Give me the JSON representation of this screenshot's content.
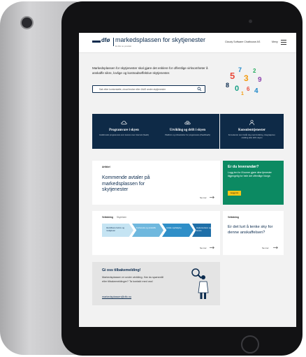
{
  "header": {
    "logo_text": "dfø",
    "site_title": "markedsplassen for skytjenester",
    "site_subtitle": "Et dfø.no produkt",
    "provider_menu": "Cloudy Software Chatbouse AS",
    "menu_label": "Meny"
  },
  "hero": {
    "intro": "Markedsplassen for skytjenester skal gjøre det enklere for offentlige virksomheter å anskaffe sikre, lovlige og kostnadseffektive skytjenester.",
    "search_placeholder": "Søk etter kontorstøtte, cloud broker eller IAAS andre skytjenester"
  },
  "categories": [
    {
      "title": "Programvare i skyen",
      "desc": "Grafiki tekst programvare som leveres over internett (SaaS)",
      "icon": "cloud-icon"
    },
    {
      "title": "Utvikling og drift i skyen",
      "desc": "Plattform og infrastruktur for programvare (PaaS/IaaS)",
      "icon": "cloud-gear-icon"
    },
    {
      "title": "Konsulenttjenester",
      "desc": "Konsulenter som bistår deg med innføring, integrasjoner, utvikling eller drift i skyen",
      "icon": "consultant-icon"
    }
  ],
  "article": {
    "tag": "Artikkel",
    "title": "Kommende avtaler på markedsplassen for skytjenester",
    "more": "Se mer"
  },
  "supplier": {
    "title": "Er du leverandør?",
    "desc": "Logg inn for å kunne gjøre dine tjenester tilgjengelig for hele det offentlige Norge.",
    "button": "Logg inn"
  },
  "guide": {
    "tag": "Veiledning",
    "tag2": "Skyreisen",
    "steps": [
      "Identifisere behov og muligheter",
      "Forberede og anskaffe",
      "Avtale oppfølging",
      "Implementere og levere"
    ],
    "more": "Se mer"
  },
  "guide2": {
    "tag": "Veiledning",
    "title": "Er det lurt å tenke sky for denne anskaffelsen?",
    "more": "Se mer"
  },
  "feedback": {
    "title": "Gi oss tilbakemelding!",
    "desc": "Markedsplassen er under utvikling. Har du spørsmål eller tilbakemeldinger? Ta kontakt med oss!",
    "link": "markedsplassen@dfo.no"
  },
  "colors": {
    "navy": "#0e2a47",
    "green": "#0c8a62",
    "yellow": "#f5c518"
  }
}
